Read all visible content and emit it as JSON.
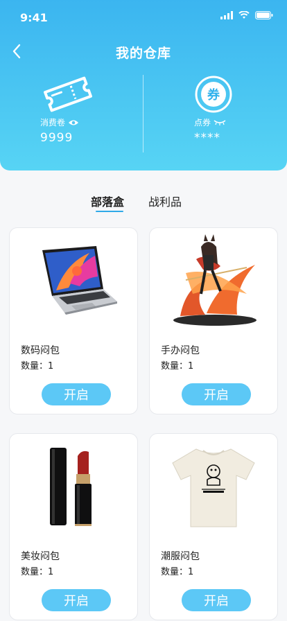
{
  "status": {
    "time": "9:41"
  },
  "nav": {
    "title": "我的仓库"
  },
  "wallet": {
    "left": {
      "label": "消费卷",
      "value": "9999"
    },
    "right": {
      "label": "点券",
      "value": "****",
      "icon_glyph": "券"
    }
  },
  "tabs": [
    {
      "label": "部落盒",
      "active": true
    },
    {
      "label": "战利品",
      "active": false
    }
  ],
  "items": [
    {
      "name": "数码闷包",
      "qty": "数量：1",
      "button": "开启",
      "image": "laptop"
    },
    {
      "name": "手办闷包",
      "qty": "数量：1",
      "button": "开启",
      "image": "figure"
    },
    {
      "name": "美妆闷包",
      "qty": "数量：1",
      "button": "开启",
      "image": "lipstick"
    },
    {
      "name": "潮服闷包",
      "qty": "数量：1",
      "button": "开启",
      "image": "tshirt"
    }
  ],
  "colors": {
    "header_top": "#3bb5f0",
    "header_bottom": "#57d4f4",
    "accent": "#2fa9e8",
    "button": "#5cc8f6"
  }
}
